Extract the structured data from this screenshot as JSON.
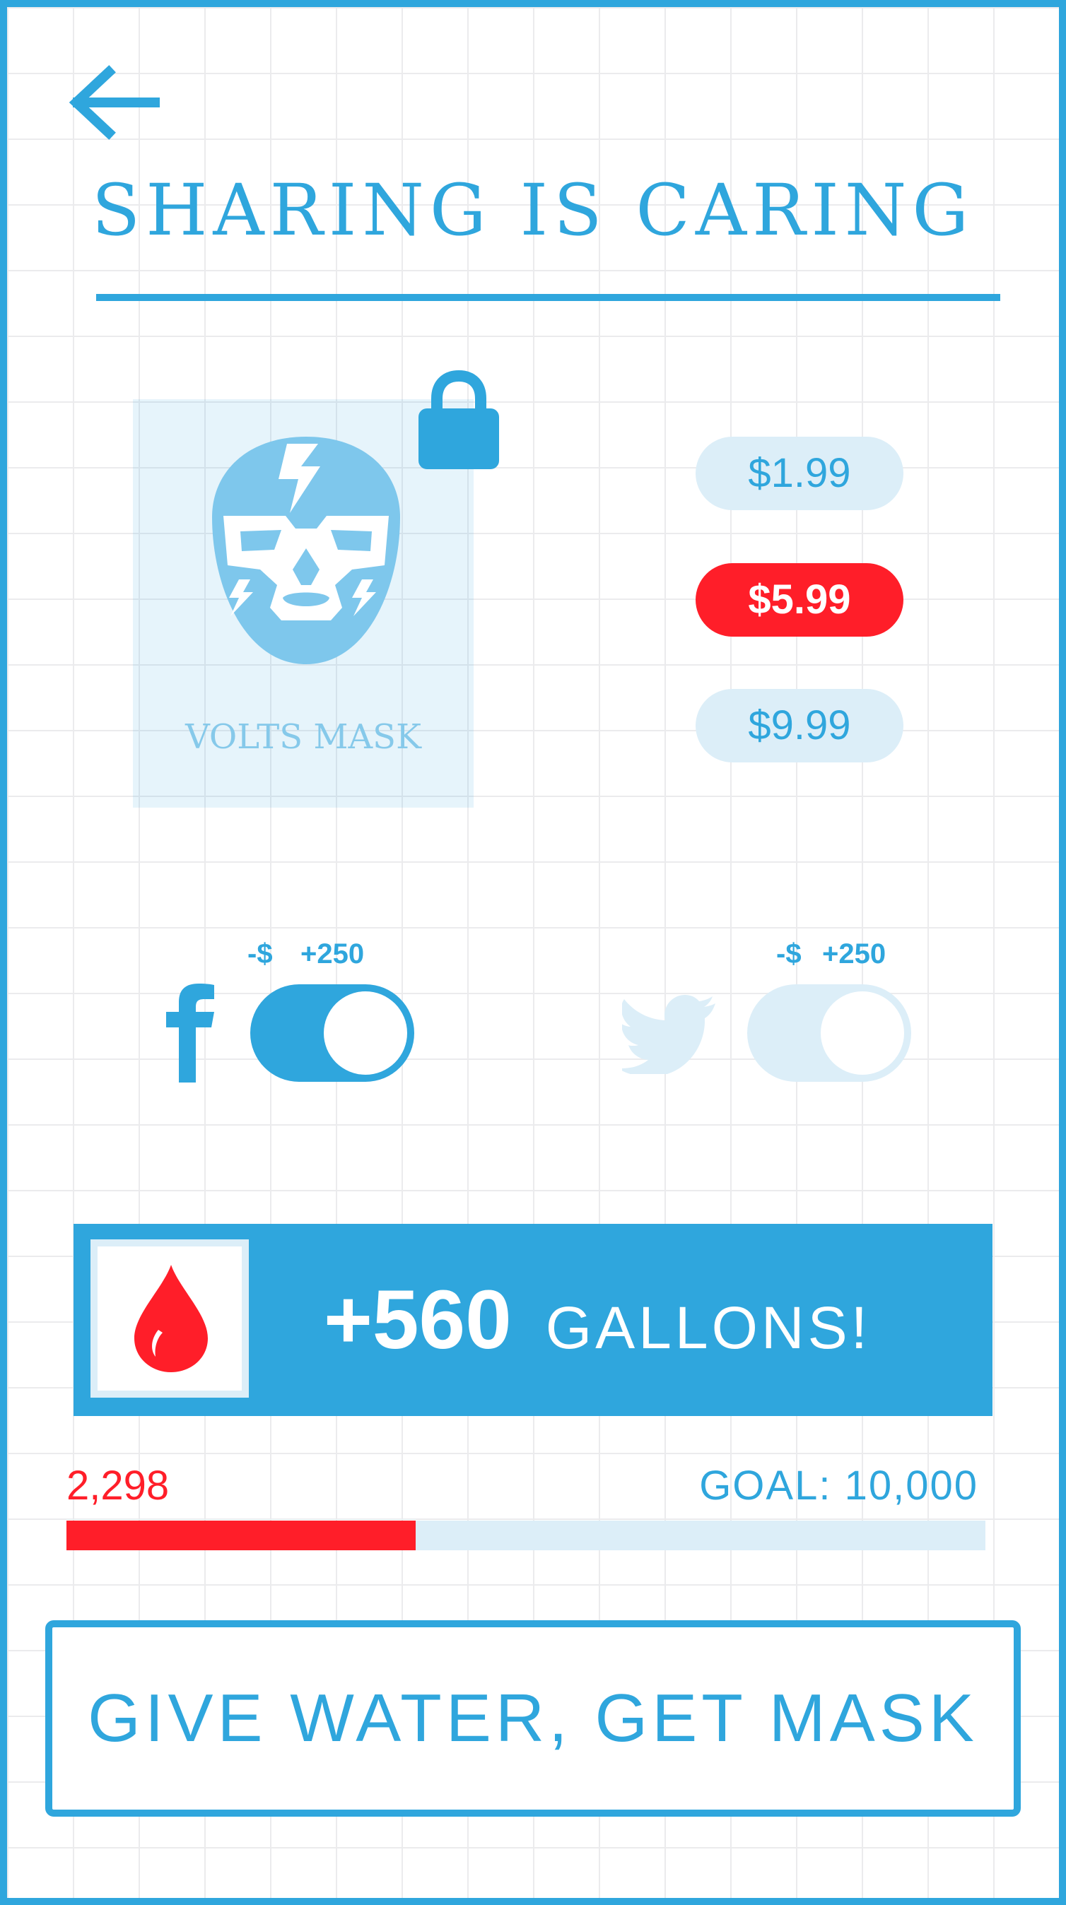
{
  "header": {
    "back_icon": "arrow-left-icon",
    "title": "SHARING IS CARING"
  },
  "reward": {
    "item_name": "VOLTS MASK",
    "icon": "wrestling-mask-icon",
    "locked": true,
    "lock_icon": "lock-icon"
  },
  "prices": [
    {
      "label": "$1.99",
      "selected": false
    },
    {
      "label": "$5.99",
      "selected": true
    },
    {
      "label": "$9.99",
      "selected": false
    }
  ],
  "social": {
    "facebook": {
      "icon": "facebook-icon",
      "bonus_minus": "-$",
      "bonus_plus": "+250",
      "enabled": true
    },
    "twitter": {
      "icon": "twitter-icon",
      "bonus_minus": "-$",
      "bonus_plus": "+250",
      "enabled": false
    }
  },
  "gallons": {
    "icon": "water-drop-icon",
    "amount": "+560",
    "unit": "GALLONS!"
  },
  "progress": {
    "current_label": "2,298",
    "goal_label": "GOAL: 10,000",
    "current": 2298,
    "goal": 10000,
    "displayed_fill_fraction": 0.38
  },
  "cta": {
    "label": "GIVE WATER, GET MASK"
  },
  "colors": {
    "primary": "#2fa6dd",
    "accent_red": "#ff1e29",
    "light_blue": "#dceef8",
    "grid_line": "#ebebed",
    "background": "#ffffff"
  }
}
